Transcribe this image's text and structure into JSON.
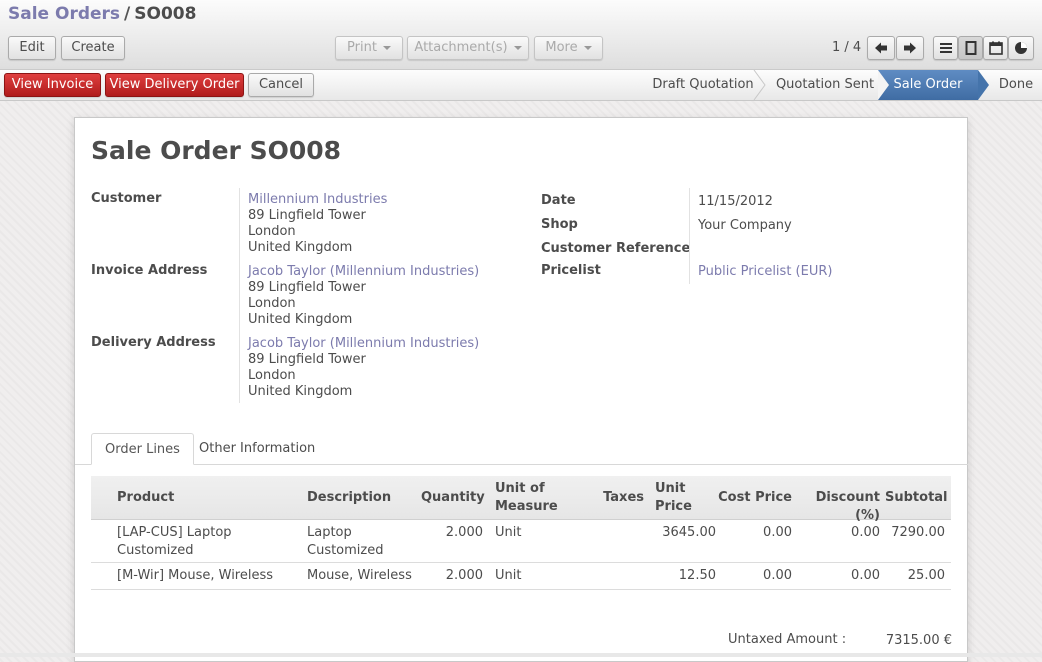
{
  "breadcrumb": {
    "parent": "Sale Orders",
    "separator": "/",
    "current": "SO008"
  },
  "toolbar": {
    "edit": "Edit",
    "create": "Create",
    "print": "Print",
    "attachments": "Attachment(s)",
    "more": "More",
    "pager": "1 / 4"
  },
  "actions": {
    "view_invoice": "View Invoice",
    "view_delivery": "View Delivery Order",
    "cancel": "Cancel"
  },
  "stages": [
    "Draft Quotation",
    "Quotation Sent",
    "Sale Order",
    "Done"
  ],
  "stage_active": "Sale Order",
  "colors": {
    "accent_link": "#7c7bad",
    "stage_active": "#4f7cb3",
    "button_red": "#c62828"
  },
  "sheet": {
    "title": "Sale Order SO008",
    "customer": {
      "label": "Customer",
      "name": "Millennium Industries",
      "line1": "89 Lingfield Tower",
      "line2": "London",
      "line3": "United Kingdom"
    },
    "invoice_address": {
      "label": "Invoice Address",
      "name": "Jacob Taylor (Millennium Industries)",
      "line1": "89 Lingfield Tower",
      "line2": "London",
      "line3": "United Kingdom"
    },
    "delivery_address": {
      "label": "Delivery Address",
      "name": "Jacob Taylor (Millennium Industries)",
      "line1": "89 Lingfield Tower",
      "line2": "London",
      "line3": "United Kingdom"
    },
    "date": {
      "label": "Date",
      "value": "11/15/2012"
    },
    "shop": {
      "label": "Shop",
      "value": "Your Company"
    },
    "customer_reference": {
      "label": "Customer Reference",
      "value": ""
    },
    "pricelist": {
      "label": "Pricelist",
      "value": "Public Pricelist (EUR)"
    }
  },
  "tabs": {
    "order_lines": "Order Lines",
    "other_info": "Other Information"
  },
  "table": {
    "headers": {
      "product": "Product",
      "description": "Description",
      "quantity": "Quantity",
      "uom_1": "Unit of",
      "uom_2": "Measure",
      "taxes": "Taxes",
      "unit_price_1": "Unit",
      "unit_price_2": "Price",
      "cost_price": "Cost Price",
      "discount": "Discount (%)",
      "subtotal": "Subtotal"
    },
    "rows": [
      {
        "product_1": "[LAP-CUS] Laptop",
        "product_2": "Customized",
        "description_1": "Laptop",
        "description_2": "Customized",
        "quantity": "2.000",
        "uom": "Unit",
        "taxes": "",
        "unit_price": "3645.00",
        "cost_price": "0.00",
        "discount": "0.00",
        "subtotal": "7290.00"
      },
      {
        "product_1": "[M-Wir] Mouse, Wireless",
        "description_1": "Mouse, Wireless",
        "quantity": "2.000",
        "uom": "Unit",
        "taxes": "",
        "unit_price": "12.50",
        "cost_price": "0.00",
        "discount": "0.00",
        "subtotal": "25.00"
      }
    ]
  },
  "totals": {
    "untaxed_label": "Untaxed Amount :",
    "untaxed_value": "7315.00 €"
  }
}
